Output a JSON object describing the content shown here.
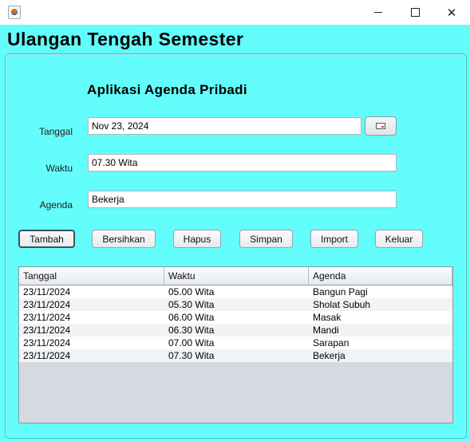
{
  "window": {
    "icon": "java-icon",
    "controls": {
      "minimize": "minimize-icon",
      "maximize": "maximize-icon",
      "close": "close-icon"
    }
  },
  "header": {
    "title": "Ulangan Tengah Semester"
  },
  "app": {
    "title": "Aplikasi Agenda Pribadi"
  },
  "form": {
    "tanggal_label": "Tanggal",
    "tanggal_value": "Nov 23, 2024",
    "waktu_label": "Waktu",
    "waktu_value": "07.30 Wita",
    "agenda_label": "Agenda",
    "agenda_value": "Bekerja",
    "calendar_icon": "calendar-icon"
  },
  "buttons": {
    "tambah": "Tambah",
    "bersihkan": "Bersihkan",
    "hapus": "Hapus",
    "simpan": "Simpan",
    "import": "Import",
    "keluar": "Keluar"
  },
  "table": {
    "columns": [
      "Tanggal",
      "Waktu",
      "Agenda"
    ],
    "rows": [
      [
        "23/11/2024",
        "05.00 Wita",
        "Bangun Pagi"
      ],
      [
        "23/11/2024",
        "05.30 Wita",
        "Sholat Subuh"
      ],
      [
        "23/11/2024",
        "06.00 Wita",
        "Masak"
      ],
      [
        "23/11/2024",
        "06.30 Wita",
        "Mandi"
      ],
      [
        "23/11/2024",
        "07.00 Wita",
        "Sarapan"
      ],
      [
        "23/11/2024",
        "07.30 Wita",
        "Bekerja"
      ]
    ]
  },
  "colors": {
    "background": "#63fdfb",
    "panel_border": "#4fb6be"
  }
}
